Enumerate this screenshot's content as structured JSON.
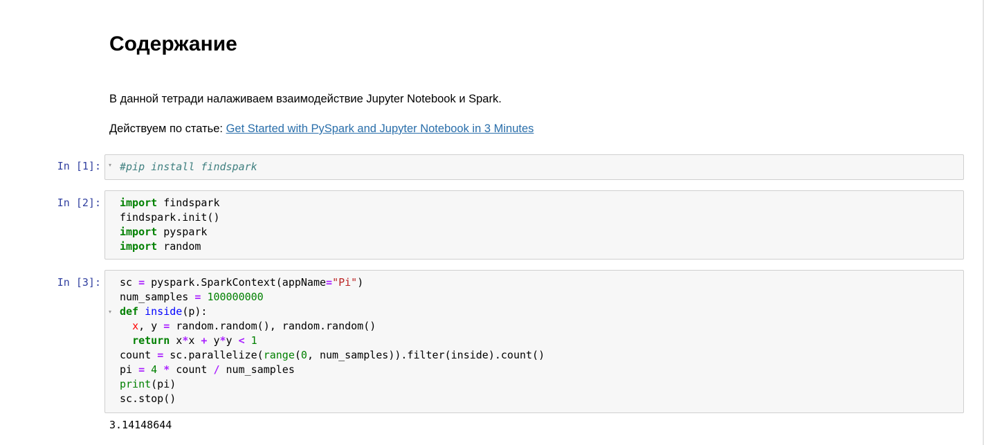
{
  "heading": "Содержание",
  "intro_text": "В данной тетради налаживаем взаимодействие Jupyter Notebook и Spark.",
  "source_prefix": "Действуем по статье: ",
  "source_link": "Get Started with PySpark and Jupyter Notebook in 3 Minutes",
  "cells": [
    {
      "prompt": "In [1]:",
      "code": [
        [
          [
            "cmt",
            "#pip install findspark"
          ]
        ]
      ]
    },
    {
      "prompt": "In [2]:",
      "code": [
        [
          [
            "kw",
            "import"
          ],
          [
            "",
            " findspark"
          ]
        ],
        [
          [
            "",
            "findspark.init()"
          ]
        ],
        [
          [
            "kw",
            "import"
          ],
          [
            "",
            " pyspark"
          ]
        ],
        [
          [
            "kw",
            "import"
          ],
          [
            "",
            " random"
          ]
        ]
      ]
    },
    {
      "prompt": "In [3]:",
      "code": [
        [
          [
            "",
            "sc "
          ],
          [
            "op",
            "="
          ],
          [
            "",
            " pyspark.SparkContext(appName"
          ],
          [
            "op",
            "="
          ],
          [
            "str",
            "\"Pi\""
          ],
          [
            "",
            ")"
          ]
        ],
        [
          [
            "",
            "num_samples "
          ],
          [
            "op",
            "="
          ],
          [
            "",
            " "
          ],
          [
            "num",
            "100000000"
          ]
        ],
        [
          [
            "kw",
            "def"
          ],
          [
            "",
            " "
          ],
          [
            "fn",
            "inside"
          ],
          [
            "",
            "(p):"
          ]
        ],
        [
          [
            "",
            "  "
          ],
          [
            "var",
            "x"
          ],
          [
            "",
            ", y "
          ],
          [
            "op",
            "="
          ],
          [
            "",
            " random.random(), random.random()"
          ]
        ],
        [
          [
            "",
            "  "
          ],
          [
            "kw",
            "return"
          ],
          [
            "",
            " x"
          ],
          [
            "op",
            "*"
          ],
          [
            "",
            "x "
          ],
          [
            "op",
            "+"
          ],
          [
            "",
            " y"
          ],
          [
            "op",
            "*"
          ],
          [
            "",
            "y "
          ],
          [
            "op",
            "<"
          ],
          [
            "",
            " "
          ],
          [
            "num",
            "1"
          ]
        ],
        [
          [
            "",
            "count "
          ],
          [
            "op",
            "="
          ],
          [
            "",
            " sc.parallelize("
          ],
          [
            "bi",
            "range"
          ],
          [
            "",
            "("
          ],
          [
            "num",
            "0"
          ],
          [
            "",
            ", num_samples)).filter(inside).count()"
          ]
        ],
        [
          [
            "",
            "pi "
          ],
          [
            "op",
            "="
          ],
          [
            "",
            " "
          ],
          [
            "num",
            "4"
          ],
          [
            "",
            " "
          ],
          [
            "op",
            "*"
          ],
          [
            "",
            " count "
          ],
          [
            "op",
            "/"
          ],
          [
            "",
            " num_samples"
          ]
        ],
        [
          [
            "bi",
            "print"
          ],
          [
            "",
            "(pi)"
          ]
        ],
        [
          [
            "",
            "sc.stop()"
          ]
        ]
      ]
    }
  ],
  "output_value": "3.14148644",
  "fold_glyph": "▾"
}
